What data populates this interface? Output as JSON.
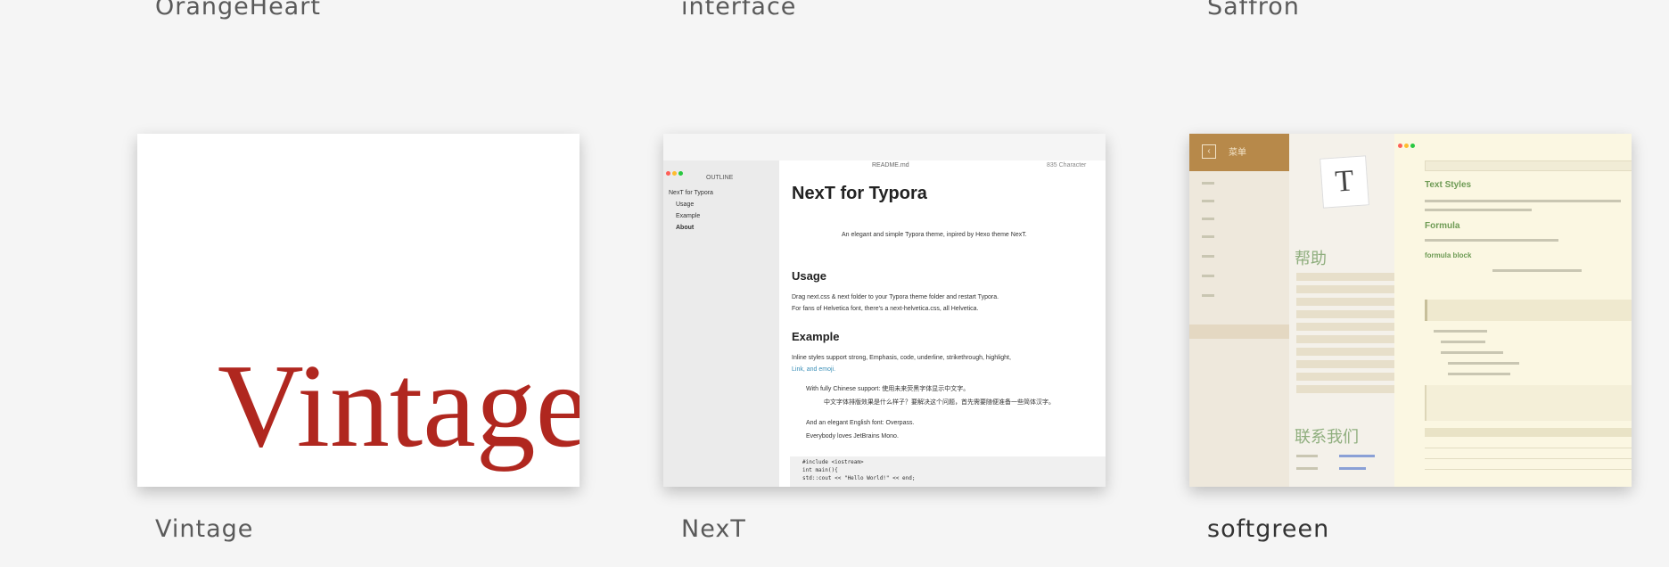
{
  "themes_top": [
    {
      "name": "OrangeHeart"
    },
    {
      "name": "interface"
    },
    {
      "name": "Saffron"
    }
  ],
  "themes_bottom": [
    {
      "name": "Vintage"
    },
    {
      "name": "NexT"
    },
    {
      "name": "softgreen"
    }
  ],
  "vintage": {
    "preview_word": "Vintage",
    "word_color": "#b0271f"
  },
  "next": {
    "window_file": "README.md",
    "window_stat": "835 Character",
    "outline_label": "OUTLINE",
    "outline_items": [
      "NexT for Typora",
      "Usage",
      "Example",
      "About"
    ],
    "title": "NexT for Typora",
    "tagline": "An elegant and simple Typora theme, inpired by Hexo theme NexT.",
    "usage_heading": "Usage",
    "usage_line1": "Drag next.css & next folder to your Typora theme folder and restart Typora.",
    "usage_line2": "For fans of Helvetica font, there's a next-helvetica.css, all Helvetica.",
    "example_heading": "Example",
    "example_line1": "Inline styles support strong, Emphasis, code, underline, strikethrough, highlight,",
    "example_line2": "Link, and emoji.",
    "bullet1": "With fully Chinese support: 使用未来荧黑字体显示中文字。",
    "bullet1_sub": "中文字体排版效果是什么样子？要解决这个问题，首先需要随便准备一些简体汉字。",
    "bullet2": "And an elegant English font: Overpass.",
    "bullet3": "Everybody loves JetBrains Mono.",
    "code_lines": [
      "#include <iostream>",
      "int main(){",
      "  std::cout << \"Hello World!\" << end;"
    ]
  },
  "softgreen": {
    "menu_label": "菜单",
    "letter": "T",
    "help_heading": "帮助",
    "contact_heading": "联系我们",
    "text_styles": "Text Styles",
    "formula": "Formula",
    "formula_block": "formula block",
    "colors": {
      "header": "#b7894a",
      "accent": "#6e9b55"
    }
  }
}
